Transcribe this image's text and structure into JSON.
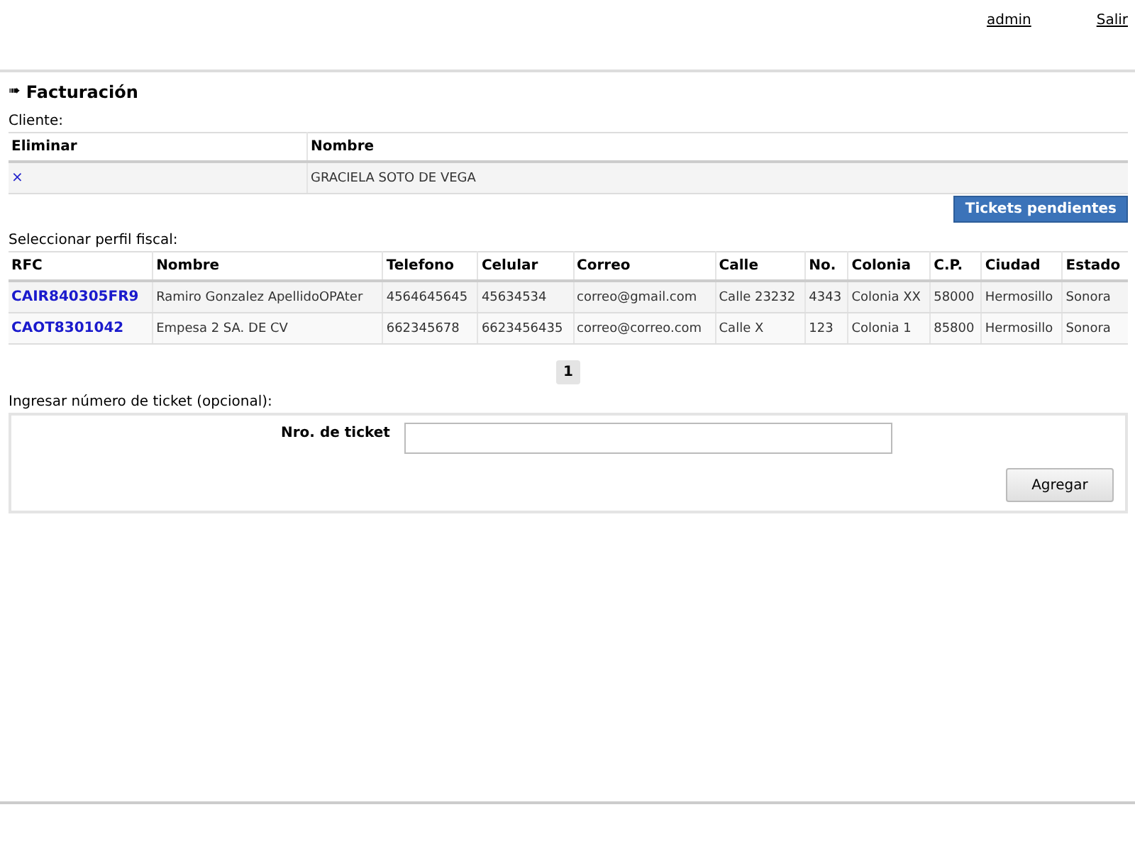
{
  "header": {
    "links": [
      "admin",
      "Salir"
    ]
  },
  "section": {
    "icon": "➠",
    "title": "Facturación"
  },
  "client": {
    "label": "Cliente:",
    "columns": [
      "Eliminar",
      "Nombre"
    ],
    "rows": [
      {
        "remove": "×",
        "name": "GRACIELA SOTO DE VEGA"
      }
    ],
    "button": "Tickets pendientes"
  },
  "profiles": {
    "label": "Seleccionar perfil fiscal:",
    "columns": [
      "RFC",
      "Nombre",
      "Telefono",
      "Celular",
      "Correo",
      "Calle",
      "No.",
      "Colonia",
      "C.P.",
      "Ciudad",
      "Estado"
    ],
    "rows": [
      [
        "CAIR840305FR9",
        "Ramiro Gonzalez ApellidoOPAter",
        "4564645645",
        "45634534",
        "correo@gmail.com",
        "Calle 23232",
        "4343",
        "Colonia XX",
        "58000",
        "Hermosillo",
        "Sonora"
      ],
      [
        "CAOT8301042",
        "Empesa 2 SA. DE CV",
        "662345678",
        "6623456435",
        "correo@correo.com",
        "Calle X",
        "123",
        "Colonia 1",
        "85800",
        "Hermosillo",
        "Sonora"
      ]
    ],
    "pages": [
      {
        "label": "1",
        "selected": true
      }
    ]
  },
  "ticket": {
    "label": "Ingresar número de ticket (opcional):",
    "field_label": "Nro. de ticket",
    "button": "Agregar"
  }
}
